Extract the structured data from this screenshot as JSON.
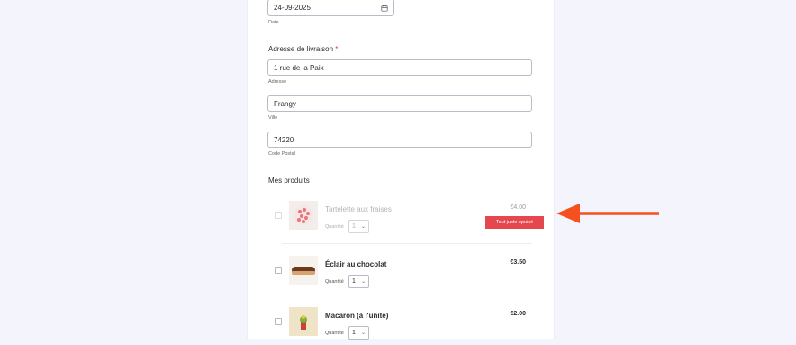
{
  "date": {
    "value": "24-09-2025",
    "sublabel": "Date"
  },
  "delivery": {
    "title": "Adresse de livraison",
    "required_mark": "*",
    "address": {
      "value": "1 rue de la Paix",
      "sublabel": "Adresse"
    },
    "city": {
      "value": "Frangy",
      "sublabel": "Ville"
    },
    "postal": {
      "value": "74220",
      "sublabel": "Code Postal"
    }
  },
  "products": {
    "title": "Mes produits",
    "qty_label": "Quantité",
    "items": [
      {
        "name": "Tartelette aux fraises",
        "price": "€4.00",
        "qty": "1",
        "badge": "Tout juste épuisé"
      },
      {
        "name": "Éclair au chocolat",
        "price": "€3.50",
        "qty": "1"
      },
      {
        "name": "Macaron (à l'unité)",
        "price": "€2.00",
        "qty": "1"
      }
    ]
  },
  "colors": {
    "arrow": "#f4511e",
    "soldout_badge": "#e5474f",
    "page_bg": "#f3f4fc"
  }
}
